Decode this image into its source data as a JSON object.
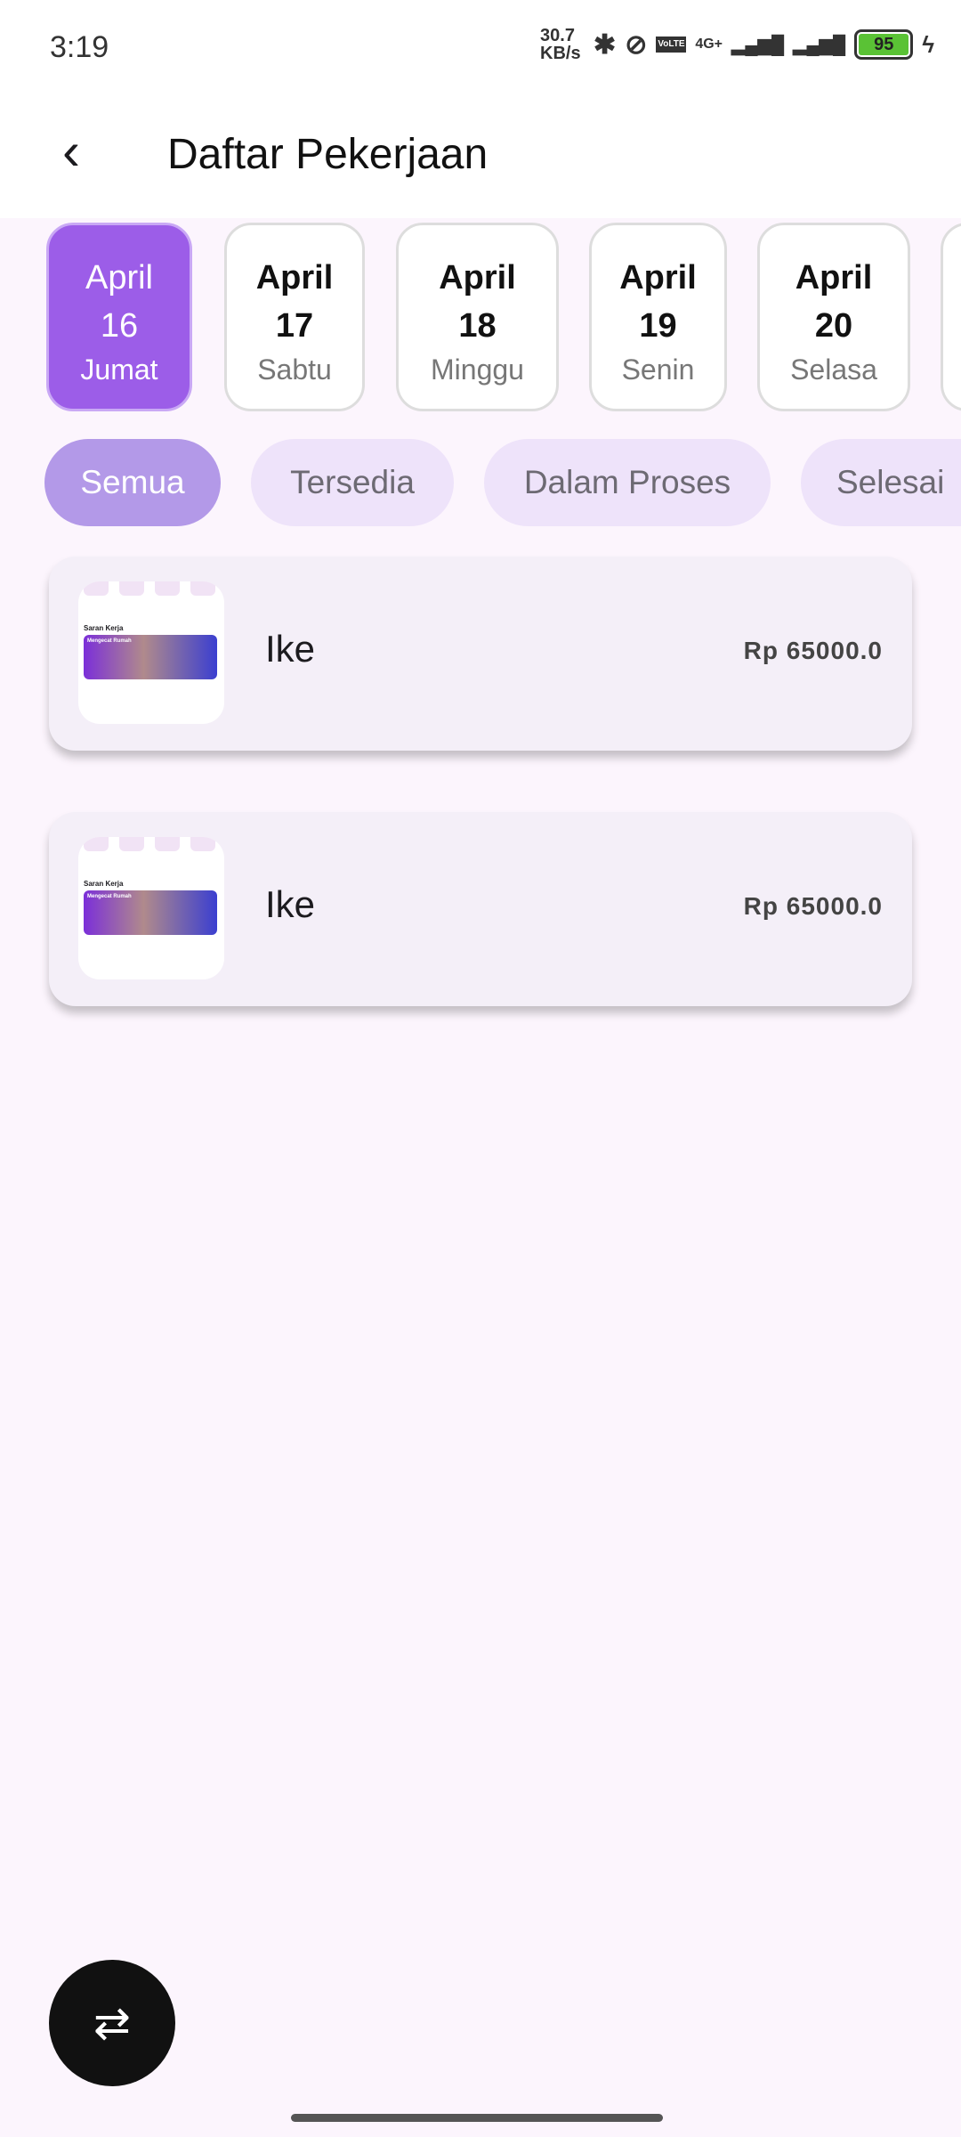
{
  "status": {
    "time": "3:19",
    "speed": "30.7 KB/s",
    "network": "4G+",
    "volte": "VoLTE",
    "battery": "95"
  },
  "header": {
    "title": "Daftar Pekerjaan"
  },
  "dates": [
    {
      "month": "April",
      "day": "16",
      "weekday": "Jumat",
      "selected": true
    },
    {
      "month": "April",
      "day": "17",
      "weekday": "Sabtu"
    },
    {
      "month": "April",
      "day": "18",
      "weekday": "Minggu"
    },
    {
      "month": "April",
      "day": "19",
      "weekday": "Senin"
    },
    {
      "month": "April",
      "day": "20",
      "weekday": "Selasa"
    }
  ],
  "filters": [
    "Semua",
    "Tersedia",
    "Dalam Proses",
    "Selesai"
  ],
  "jobs": [
    {
      "name": "Ike",
      "price": "Rp 65000.0",
      "thumb_title": "Saran Kerja",
      "thumb_banner": "Mengecat Rumah"
    },
    {
      "name": "Ike",
      "price": "Rp 65000.0",
      "thumb_title": "Saran Kerja",
      "thumb_banner": "Mengecat Rumah"
    }
  ]
}
